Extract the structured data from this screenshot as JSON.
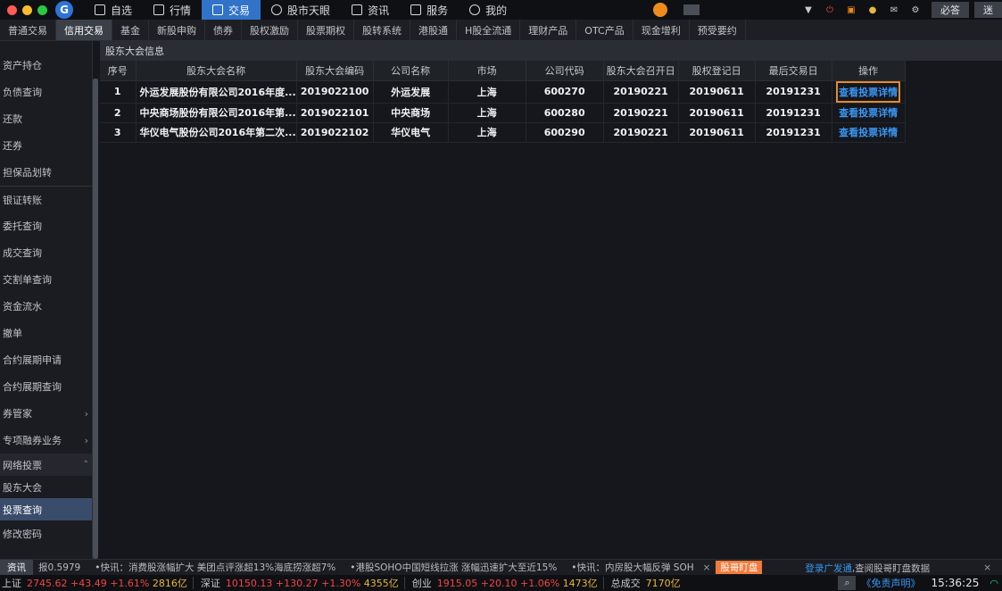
{
  "nav": {
    "items": [
      {
        "label": "自选",
        "icon": "star-icon"
      },
      {
        "label": "行情",
        "icon": "chart-icon"
      },
      {
        "label": "交易",
        "icon": "trade-icon",
        "active": true
      },
      {
        "label": "股市天眼",
        "icon": "eye-icon"
      },
      {
        "label": "资讯",
        "icon": "news-icon"
      },
      {
        "label": "服务",
        "icon": "briefcase-icon"
      },
      {
        "label": "我的",
        "icon": "user-icon"
      }
    ],
    "right_buttons": [
      "必答",
      "迷"
    ]
  },
  "tabs": [
    "普通交易",
    "信用交易",
    "基金",
    "新股申购",
    "债券",
    "股权激励",
    "股票期权",
    "股转系统",
    "港股通",
    "H股全流通",
    "理财产品",
    "OTC产品",
    "现金增利",
    "预受要约"
  ],
  "sidebar": {
    "items": [
      {
        "label": "资产持仓"
      },
      {
        "label": "负债查询"
      },
      {
        "label": "还款"
      },
      {
        "label": "还券"
      },
      {
        "label": "担保品划转"
      },
      {
        "label": "银证转账"
      },
      {
        "label": "委托查询"
      },
      {
        "label": "成交查询"
      },
      {
        "label": "交割单查询"
      },
      {
        "label": "资金流水"
      },
      {
        "label": "撤单"
      },
      {
        "label": "合约展期申请"
      },
      {
        "label": "合约展期查询"
      },
      {
        "label": "券管家"
      },
      {
        "label": "专项融券业务"
      },
      {
        "label": "网络投票"
      },
      {
        "label": "股东大会"
      },
      {
        "label": "投票查询"
      },
      {
        "label": "修改密码"
      }
    ]
  },
  "main": {
    "section_title": "股东大会信息",
    "columns": [
      "序号",
      "股东大会名称",
      "股东大会编码",
      "公司名称",
      "市场",
      "公司代码",
      "股东大会召开日",
      "股权登记日",
      "最后交易日",
      "操作"
    ],
    "rows": [
      {
        "no": "1",
        "name": "外运发展股份有限公司2016年度...",
        "code": "2019022100",
        "company": "外运发展",
        "market": "上海",
        "stock": "600270",
        "meeting_date": "20190221",
        "record_date": "20190611",
        "last_trade": "20191231",
        "action": "查看投票详情"
      },
      {
        "no": "2",
        "name": "中央商场股份有限公司2016年第...",
        "code": "2019022101",
        "company": "中央商场",
        "market": "上海",
        "stock": "600280",
        "meeting_date": "20190221",
        "record_date": "20190611",
        "last_trade": "20191231",
        "action": "查看投票详情"
      },
      {
        "no": "3",
        "name": "华仪电气股份公司2016年第二次...",
        "code": "2019022102",
        "company": "华仪电气",
        "market": "上海",
        "stock": "600290",
        "meeting_date": "20190221",
        "record_date": "20190611",
        "last_trade": "20191231",
        "action": "查看投票详情"
      }
    ]
  },
  "ticker": {
    "label": "资讯",
    "items": [
      "报0.5979",
      "•快讯：消费股涨幅扩大 美团点评涨超13%海底捞涨超7%",
      "•港股SOHO中国短线拉涨 涨幅迅速扩大至近15%",
      "•快讯：内房股大幅反弹 SOH"
    ],
    "close": "×",
    "badge": "股哥盯盘",
    "promo_link": "登录广发通",
    "promo_text": ",查阅股哥盯盘数据",
    "promo_close": "×"
  },
  "status": {
    "sh": {
      "name": "上证",
      "value": "2745.62",
      "change": "+43.49",
      "pct": "+1.61%",
      "amount": "2816亿"
    },
    "sz": {
      "name": "深证",
      "value": "10150.13",
      "change": "+130.27",
      "pct": "+1.30%",
      "amount": "4355亿"
    },
    "cy": {
      "name": "创业",
      "value": "1915.05",
      "change": "+20.10",
      "pct": "+1.06%",
      "amount": "1473亿"
    },
    "total_label": "总成交",
    "total": "7170亿",
    "disclaimer": "《免责声明》",
    "time": "15:36:25"
  },
  "colors": {
    "accent": "#3173c9",
    "up": "#f24545",
    "amount": "#e8b83a",
    "link": "#3a97f3",
    "focus": "#e58a2c"
  }
}
